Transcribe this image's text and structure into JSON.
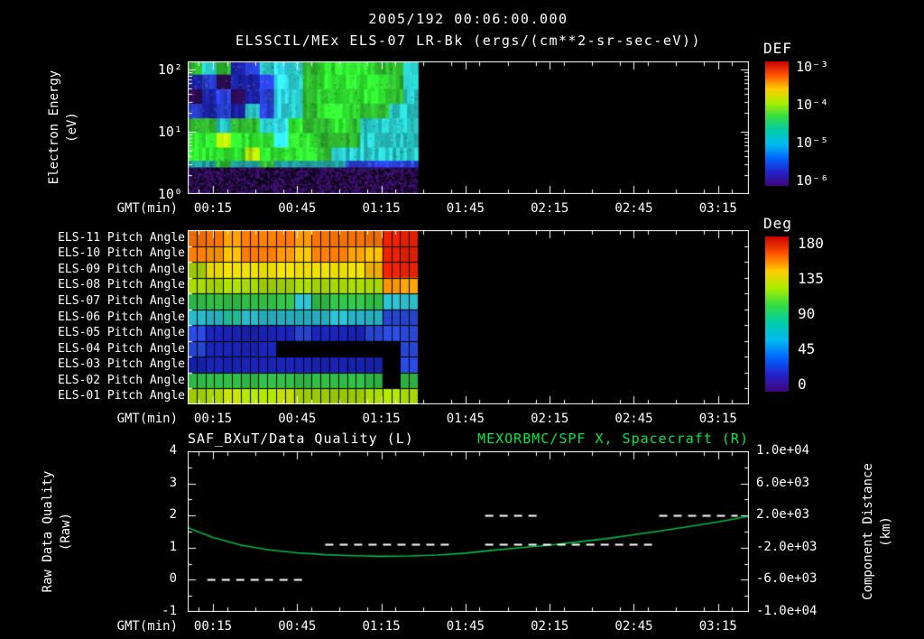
{
  "header": {
    "title": "2005/192 00:06:00.000",
    "subtitle": "ELSSCIL/MEx ELS-07 LR-Bk (ergs/(cm**2-sr-sec-eV))"
  },
  "time_axis": {
    "label": "GMT(min)",
    "start_min": 6,
    "end_min": 206,
    "tick_labels": [
      "00:15",
      "00:45",
      "01:15",
      "01:45",
      "02:15",
      "02:45",
      "03:15"
    ],
    "tick_minutes": [
      15,
      45,
      75,
      105,
      135,
      165,
      195
    ]
  },
  "palette": {
    "rainbow": [
      "#c80000",
      "#ff5500",
      "#ffcc00",
      "#aaee00",
      "#33dd44",
      "#00ccaa",
      "#00bbee",
      "#0066ff",
      "#2222cc",
      "#41067a"
    ]
  },
  "chart_data": [
    {
      "id": "electron-energy-spectrogram",
      "type": "heatmap",
      "ylabel": "Electron Energy\n(eV)",
      "xlabel": "GMT(min)",
      "yscale": "log",
      "ylim": [
        1,
        135
      ],
      "ytick_labels": [
        "10²",
        "10¹",
        "10⁰"
      ],
      "ytick_logs": [
        2,
        1,
        0
      ],
      "data_start_min": 6,
      "data_end_min": 88,
      "colorbar": {
        "title": "DEF",
        "tick_labels": [
          "10⁻³",
          "10⁻⁴",
          "10⁻⁵",
          "10⁻⁶"
        ]
      },
      "grid": {
        "row_fractions": [
          0.1,
          0.11,
          0.11,
          0.11,
          0.11,
          0.11,
          0.1,
          0.05,
          0.2
        ],
        "rows": [
          [
            "#2eb82e",
            "#28c8c8",
            "#2eb82e",
            "#1a20a0",
            "#2840d8",
            "#28c8c8",
            "#30d8e8",
            "#28c8c8",
            "#2eb82e",
            "#30e830",
            "#30e830",
            "#30e830",
            "#30e830",
            "#2eb82e",
            "#2eb82e",
            "#28c8c8"
          ],
          [
            "#1a20a0",
            "#2840d8",
            "#2a0a50",
            "#1a20a0",
            "#1a20a0",
            "#2840d8",
            "#30d8e8",
            "#28c8c8",
            "#2eb82e",
            "#30e830",
            "#30e830",
            "#30e830",
            "#30e830",
            "#30e830",
            "#2eb82e",
            "#28c8c8"
          ],
          [
            "#2a0a50",
            "#1a20a0",
            "#2840d8",
            "#2a0a50",
            "#1a20a0",
            "#2840d8",
            "#30d8e8",
            "#28c8c8",
            "#2eb82e",
            "#30e830",
            "#30e830",
            "#30e830",
            "#30e830",
            "#30e830",
            "#2eb82e",
            "#28c8c8"
          ],
          [
            "#2840d8",
            "#1a20a0",
            "#2840d8",
            "#1a20a0",
            "#28c8c8",
            "#2840d8",
            "#30d8e8",
            "#28c8c8",
            "#2eb82e",
            "#30e830",
            "#30e830",
            "#30e830",
            "#2eb82e",
            "#2eb82e",
            "#28c8c8",
            "#28c8c8"
          ],
          [
            "#2eb82e",
            "#2eb82e",
            "#28c8c8",
            "#2eb82e",
            "#2eb82e",
            "#28c8c8",
            "#30d8e8",
            "#30e830",
            "#2eb82e",
            "#2eb82e",
            "#30e830",
            "#2eb82e",
            "#28c8c8",
            "#28c8c8",
            "#28c8c8",
            "#28c8c8"
          ],
          [
            "#30e830",
            "#30e830",
            "#b8e800",
            "#30e830",
            "#30e830",
            "#30e830",
            "#30d8e8",
            "#30e830",
            "#30e830",
            "#2eb82e",
            "#2eb82e",
            "#2eb82e",
            "#28c8c8",
            "#28c8c8",
            "#28c8c8",
            "#28c8c8"
          ],
          [
            "#30e830",
            "#30e830",
            "#30e830",
            "#30e830",
            "#b8e800",
            "#30e830",
            "#30e830",
            "#30e830",
            "#30e830",
            "#2eb82e",
            "#28c8c8",
            "#28c8c8",
            "#28c8c8",
            "#28c8c8",
            "#28c8c8",
            "#28c8c8"
          ],
          [
            "#1e9898",
            "#1e9898",
            "#2eb82e",
            "#1e9898",
            "#1e9898",
            "#2eb82e",
            "#1e9898",
            "#1e9898",
            "#1e9898",
            "#1e9898",
            "#1e9898",
            "#2840d8",
            "#2840d8",
            "#2840d8",
            "#2840d8",
            "#2840d8"
          ],
          [
            "#2a0a50",
            "#2a0a50",
            "#2a0a50",
            "#2a0a50",
            "#2a0a50",
            "#2a0a50",
            "#2a0a50",
            "#2a0a50",
            "#2a0a50",
            "#2a0a50",
            "#2a0a50",
            "#2a0a50",
            "#2a0a50",
            "#2a0a50",
            "#2a0a50",
            "#2a0a50"
          ]
        ]
      }
    },
    {
      "id": "pitch-angle-panels",
      "type": "heatmap",
      "xlabel": "GMT(min)",
      "data_start_min": 6,
      "data_end_min": 88,
      "row_labels": [
        "ELS-11 Pitch Angle",
        "ELS-10 Pitch Angle",
        "ELS-09 Pitch Angle",
        "ELS-08 Pitch Angle",
        "ELS-07 Pitch Angle",
        "ELS-06 Pitch Angle",
        "ELS-05 Pitch Angle",
        "ELS-04 Pitch Angle",
        "ELS-03 Pitch Angle",
        "ELS-02 Pitch Angle",
        "ELS-01 Pitch Angle"
      ],
      "colorbar": {
        "title": "Deg",
        "tick_labels": [
          "180",
          "135",
          "90",
          "45",
          "0"
        ]
      },
      "grid": {
        "rows": [
          [
            "#ff7800",
            "#ff7800",
            "#ff9900",
            "#ff7800",
            "#ff7800",
            "#ff7800",
            "#ff9900",
            "#ff7800",
            "#ff7800",
            "#ff7800",
            "#ff7800",
            "#e82000",
            "#e82000"
          ],
          [
            "#ff7800",
            "#ff9900",
            "#ffbb00",
            "#ff7800",
            "#ff7800",
            "#ff9900",
            "#ffbb00",
            "#ff7800",
            "#ff7800",
            "#ff9900",
            "#ffbb00",
            "#e82000",
            "#e82000"
          ],
          [
            "#a8d800",
            "#e8d800",
            "#e8d800",
            "#e8d800",
            "#e8d800",
            "#e8d800",
            "#e8d800",
            "#e8d800",
            "#e8d800",
            "#e8d800",
            "#ffbb00",
            "#e82000",
            "#e82000"
          ],
          [
            "#a8d800",
            "#a8d800",
            "#a8d800",
            "#a8d800",
            "#a8d800",
            "#a8d800",
            "#a8d800",
            "#a8d800",
            "#a8d800",
            "#a8d800",
            "#a8d800",
            "#ff9900",
            "#ff9900"
          ],
          [
            "#30c048",
            "#30c048",
            "#30c048",
            "#30c048",
            "#30c048",
            "#30c048",
            "#28b8c8",
            "#30c048",
            "#30c048",
            "#30c048",
            "#30c048",
            "#28b8c8",
            "#28b8c8"
          ],
          [
            "#28b8c8",
            "#28b8c8",
            "#20b890",
            "#28b8c8",
            "#28b8c8",
            "#28b8c8",
            "#28b8c8",
            "#28b8c8",
            "#28b8c8",
            "#28b8c8",
            "#28b8c8",
            "#2848d8",
            "#2848d8"
          ],
          [
            "#2848d8",
            "#1822b0",
            "#1822b0",
            "#1822b0",
            "#1822b0",
            "#1822b0",
            "#2848d8",
            "#1822b0",
            "#1822b0",
            "#1822b0",
            "#2848d8",
            "#2848d8",
            "#2848d8"
          ],
          [
            "#2848d8",
            "#1822b0",
            "#1822b0",
            "#1822b0",
            "#1822b0",
            "#000000",
            "#000000",
            "#000000",
            "#000000",
            "#000000",
            "#000000",
            "#000000",
            "#2848d8"
          ],
          [
            "#1822b0",
            "#1822b0",
            "#1822b0",
            "#1822b0",
            "#1822b0",
            "#1822b0",
            "#1822b0",
            "#1822b0",
            "#1822b0",
            "#1822b0",
            "#1822b0",
            "#000000",
            "#2848d8"
          ],
          [
            "#30c048",
            "#30c048",
            "#30c048",
            "#30c048",
            "#30c048",
            "#30c048",
            "#30c048",
            "#30c048",
            "#30c048",
            "#30c048",
            "#30c048",
            "#000000",
            "#30c048"
          ],
          [
            "#a8d800",
            "#a8d800",
            "#c8e000",
            "#a8d800",
            "#a8d800",
            "#c8e000",
            "#a8d800",
            "#a8d800",
            "#a8d800",
            "#a8d800",
            "#a8d800",
            "#a8d800",
            "#a8d800"
          ]
        ]
      }
    },
    {
      "id": "quality-and-distance",
      "type": "line",
      "title_left": "SAF_BXuT/Data Quality (L)",
      "title_right": "MEXORBMC/SPF X, Spacecraft (R)",
      "title_right_color": "#00e840",
      "ylabel_left": "Raw Data Quality\n(Raw)",
      "ylabel_right": "Component Distance\n(km)",
      "ylim_left": [
        -1,
        4
      ],
      "ylim_right": [
        -10000,
        10000
      ],
      "ytick_labels_left": [
        "4",
        "3",
        "2",
        "1",
        "0",
        "-1"
      ],
      "ytick_labels_right": [
        "1.0e+04",
        "6.0e+03",
        "2.0e+03",
        "-2.0e+03",
        "-6.0e+03",
        "-1.0e+04"
      ],
      "series": [
        {
          "name": "MEXORBMC/SPF X, Spacecraft (R)",
          "color": "#00bb44",
          "points_min_value": [
            [
              6,
              1.62
            ],
            [
              15,
              1.32
            ],
            [
              25,
              1.08
            ],
            [
              35,
              0.93
            ],
            [
              45,
              0.84
            ],
            [
              55,
              0.78
            ],
            [
              65,
              0.75
            ],
            [
              75,
              0.73
            ],
            [
              85,
              0.74
            ],
            [
              95,
              0.77
            ],
            [
              105,
              0.83
            ],
            [
              115,
              0.92
            ],
            [
              125,
              1.0
            ],
            [
              135,
              1.08
            ],
            [
              145,
              1.18
            ],
            [
              155,
              1.28
            ],
            [
              165,
              1.4
            ],
            [
              175,
              1.53
            ],
            [
              185,
              1.66
            ],
            [
              195,
              1.8
            ],
            [
              206,
              1.98
            ]
          ]
        }
      ],
      "quality_segments": [
        {
          "value": 0,
          "start_min": 13,
          "end_min": 48
        },
        {
          "value": 1.1,
          "start_min": 55,
          "end_min": 101
        },
        {
          "value": 2,
          "start_min": 112,
          "end_min": 131
        },
        {
          "value": 1.1,
          "start_min": 112,
          "end_min": 173
        },
        {
          "value": 2,
          "start_min": 174,
          "end_min": 202
        }
      ]
    }
  ]
}
